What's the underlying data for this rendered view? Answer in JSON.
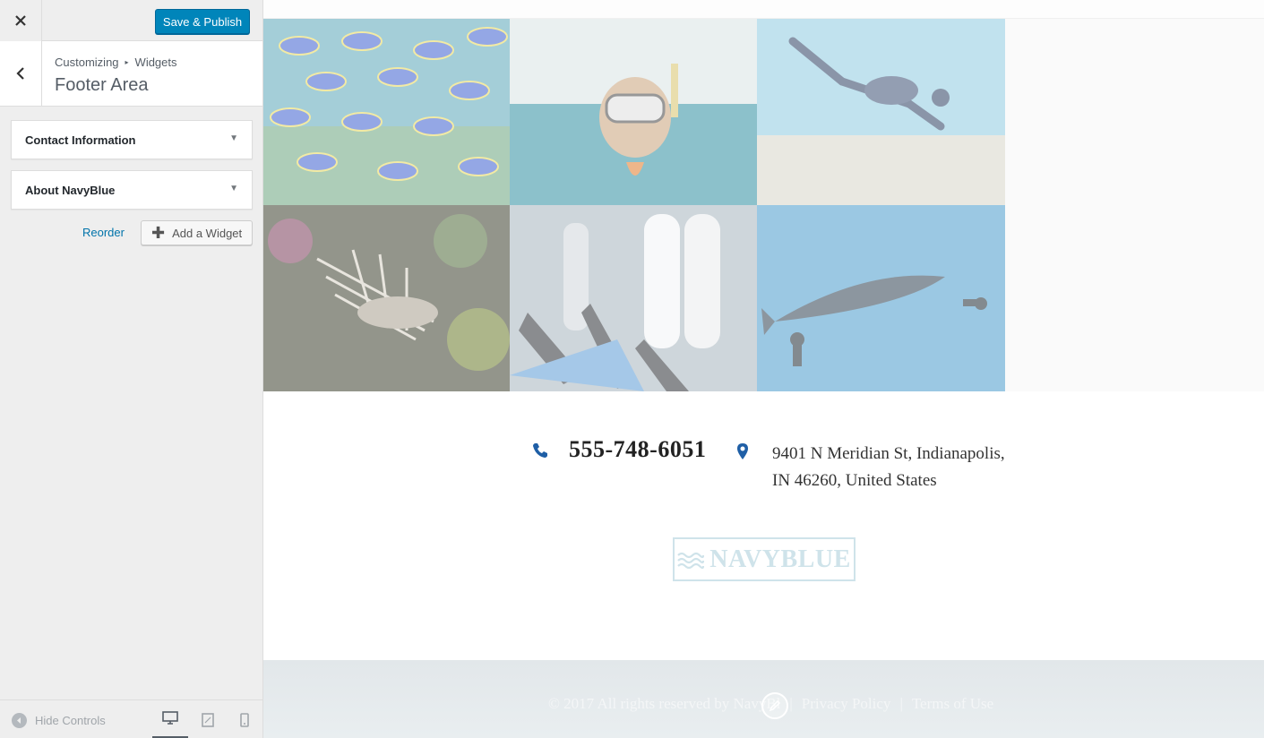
{
  "customizer": {
    "publish_label": "Save & Publish",
    "breadcrumb": [
      "Customizing",
      "Widgets"
    ],
    "breadcrumb_separator": "▸",
    "section_title": "Footer Area",
    "widgets": [
      {
        "title": "Contact Information"
      },
      {
        "title": "About NavyBlue"
      }
    ],
    "reorder_label": "Reorder",
    "add_widget_label": "Add a Widget",
    "hide_controls_label": "Hide Controls",
    "devices": [
      "desktop",
      "tablet",
      "mobile"
    ],
    "active_device": "desktop",
    "accent_color": "#0085ba"
  },
  "preview": {
    "gallery": [
      {
        "subject": "school of blue fish over coral"
      },
      {
        "subject": "child snorkeling with mask"
      },
      {
        "subject": "scuba diver in clear water"
      },
      {
        "subject": "lionfish on reef"
      },
      {
        "subject": "scuba tanks and fins"
      },
      {
        "subject": "whale shark with divers"
      }
    ],
    "contact": {
      "phone": "555-748-6051",
      "address": "9401 N Meridian St, Indianapolis, IN 46260, United States"
    },
    "logo_text": "NAVYBLUE",
    "footer": {
      "copyright": "© 2017 All rights reserved by NavyBl",
      "separator": "|",
      "links": [
        "Privacy Policy",
        "Terms of Use"
      ]
    }
  }
}
